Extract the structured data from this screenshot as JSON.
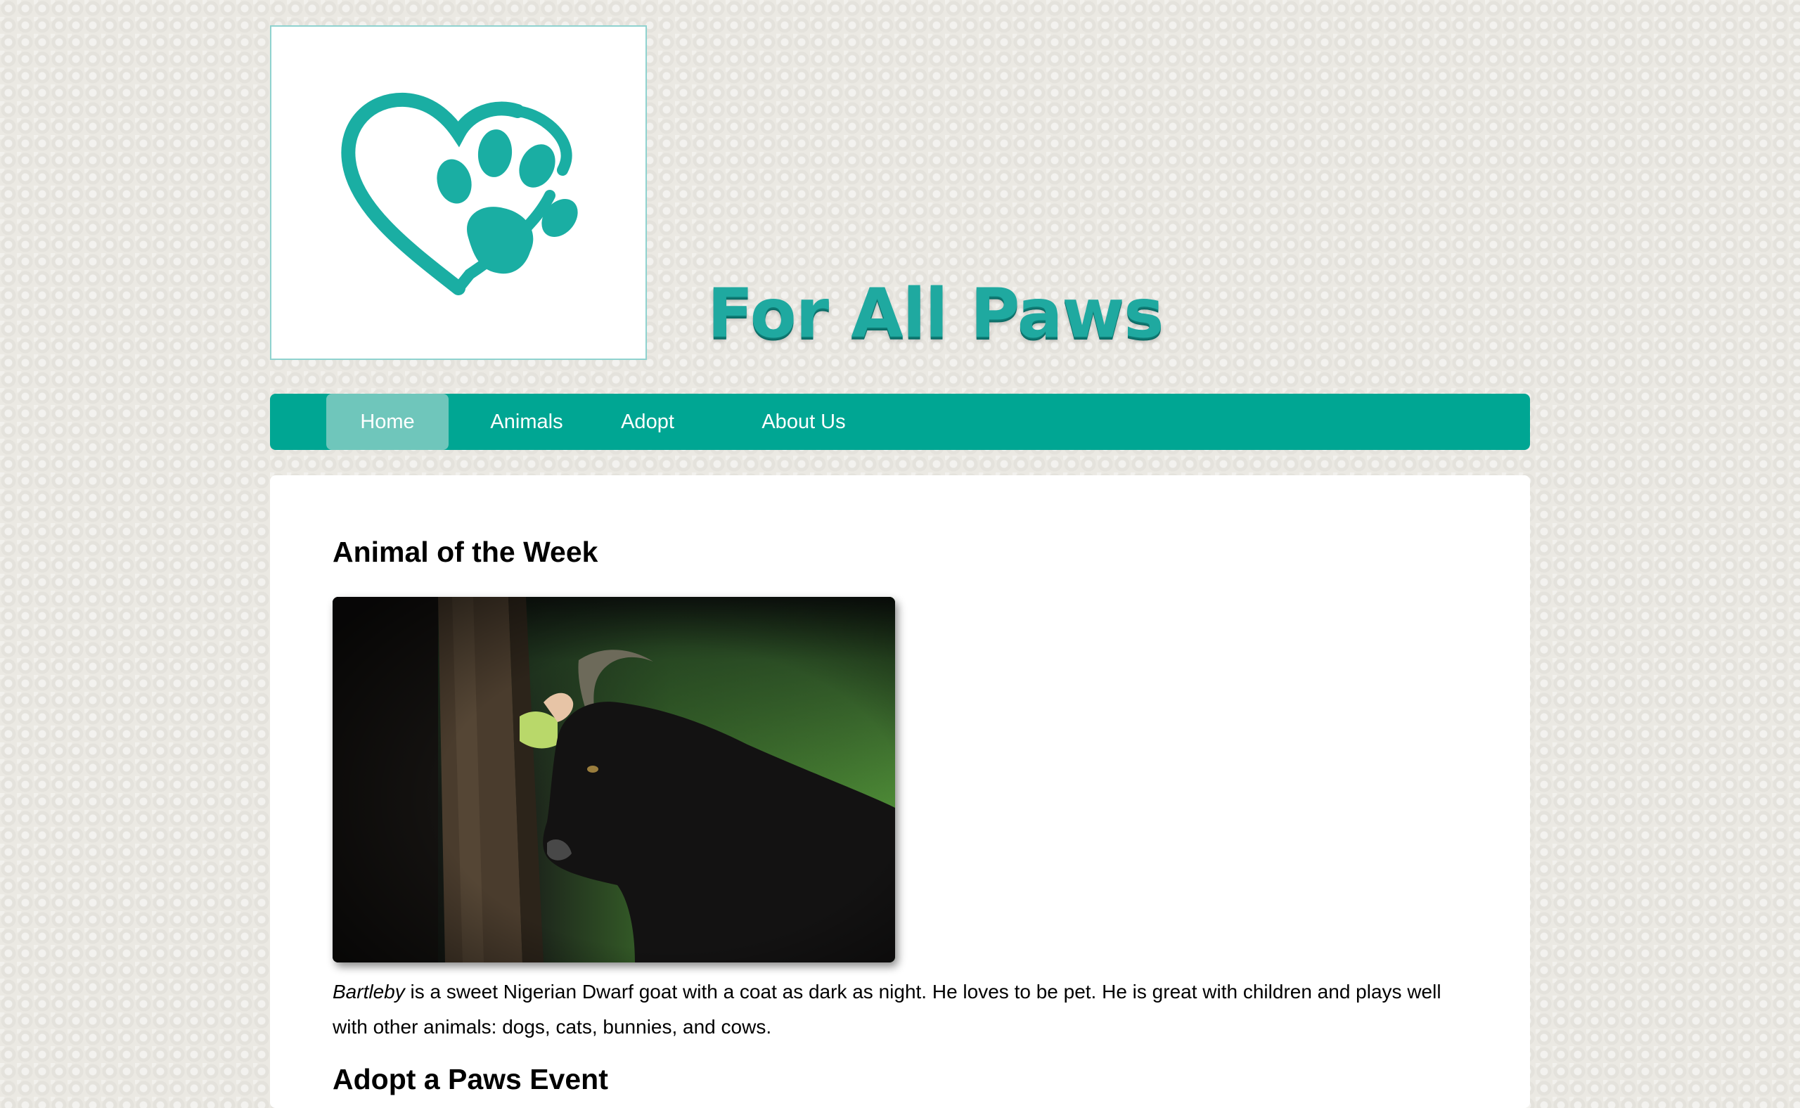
{
  "site": {
    "title": "For All Paws",
    "logo_icon": "heart-paw-icon",
    "brand_color": "#00a693",
    "active_tab_color": "#6fc6bb"
  },
  "nav": {
    "items": [
      {
        "label": "Home",
        "active": true
      },
      {
        "label": "Animals",
        "active": false
      },
      {
        "label": "Adopt",
        "active": false
      },
      {
        "label": "About Us",
        "active": false
      }
    ]
  },
  "main": {
    "section_title": "Animal of the Week",
    "animal_name": "Bartleby",
    "animal_description": " is a sweet Nigerian Dwarf goat with a coat as dark as night. He loves to be pet. He is great with children and plays well with other animals: dogs, cats, bunnies, and cows.",
    "next_heading_partial": "Adopt a Paws Event"
  }
}
